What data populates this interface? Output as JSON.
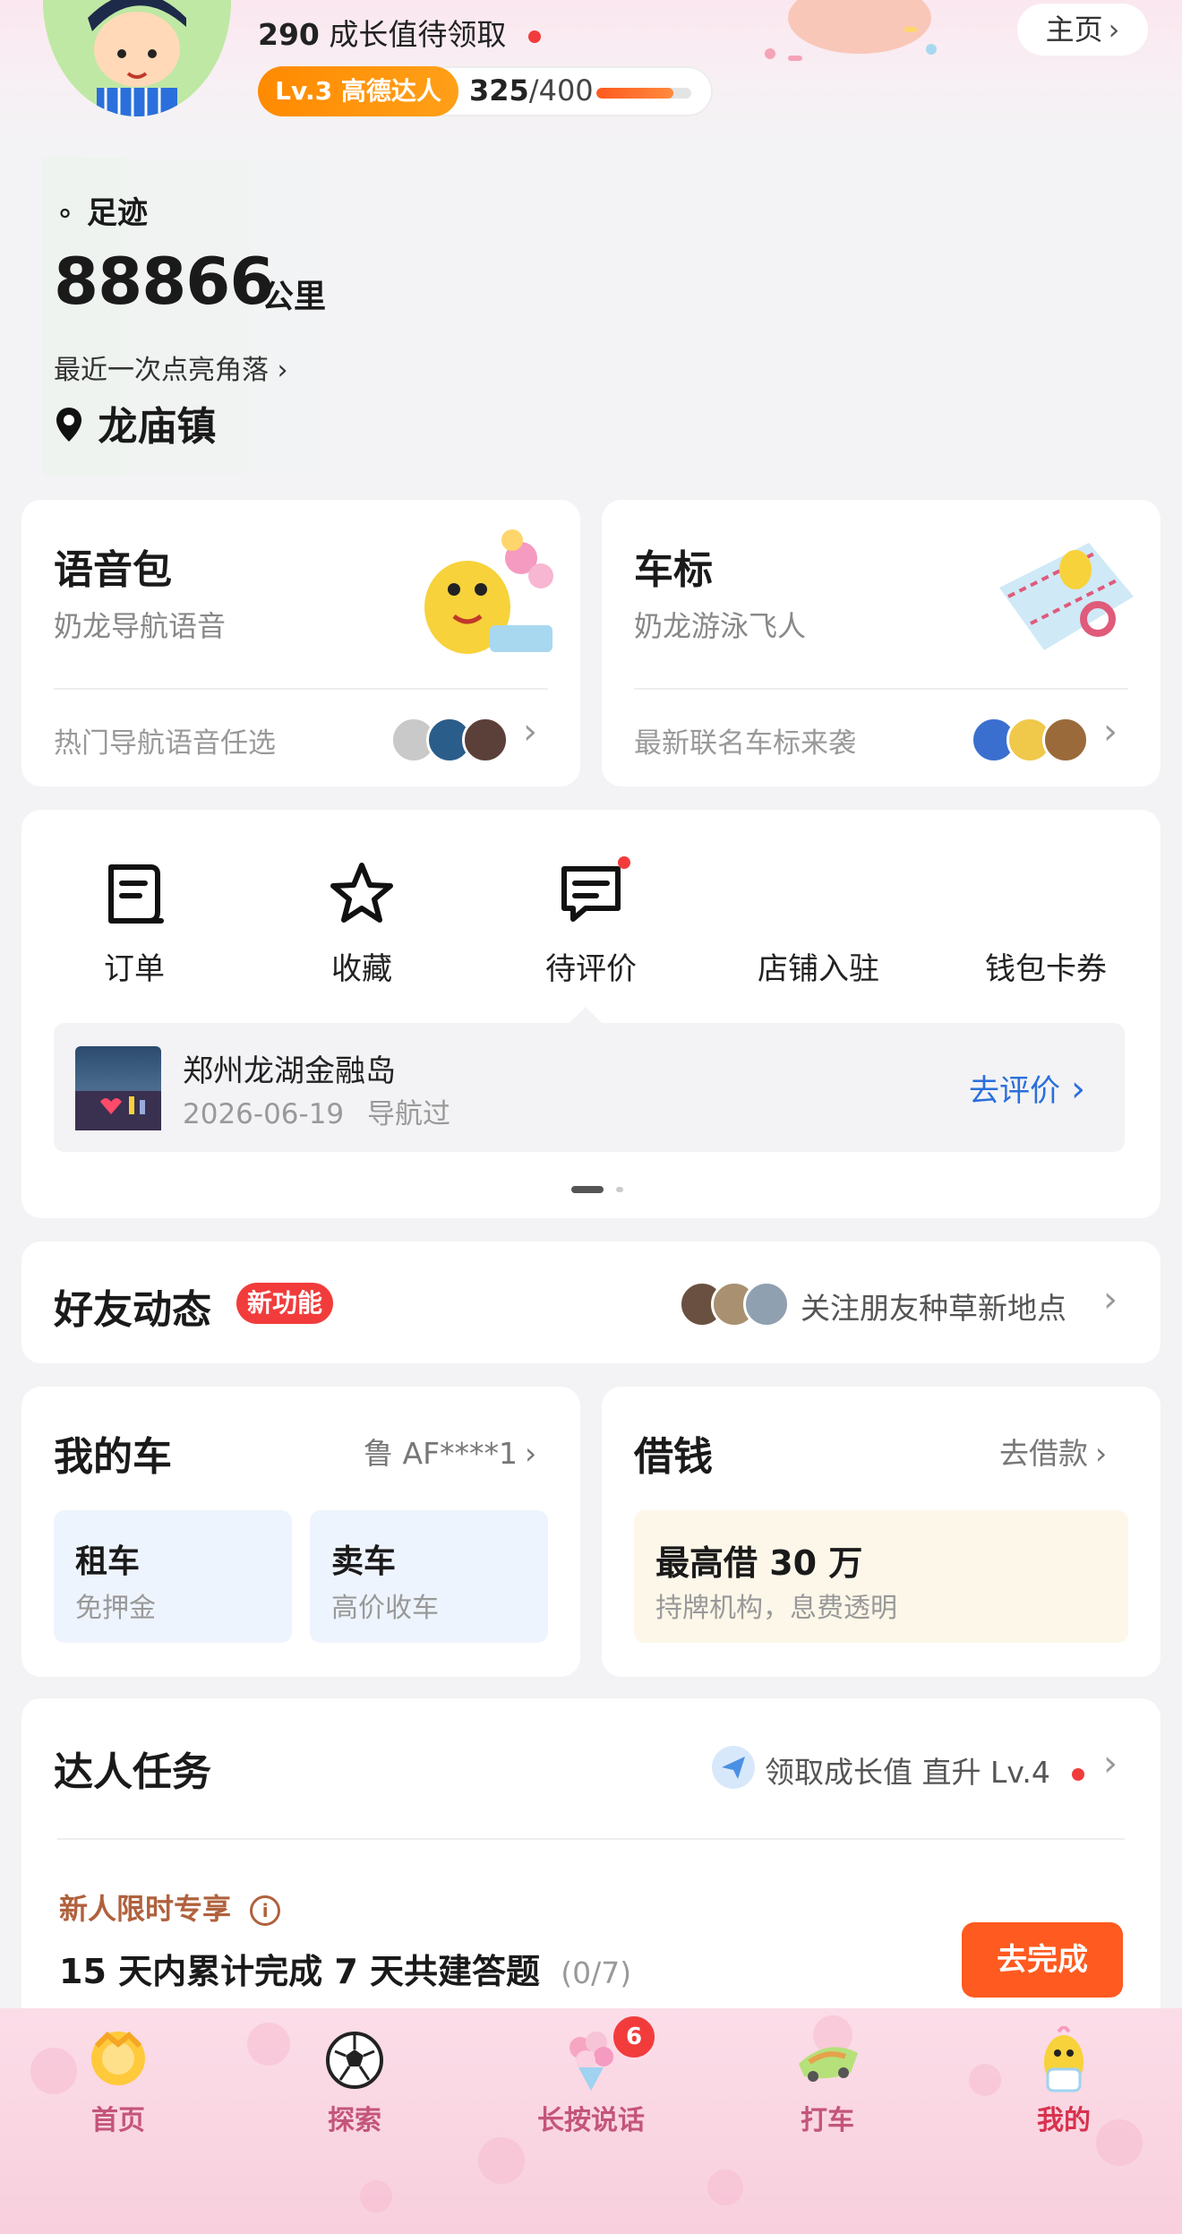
{
  "header": {
    "growth_points": "290",
    "growth_text": "成长值待领取",
    "level_badge": "Lv.3 高德达人",
    "level_current": "325",
    "level_max": "/400",
    "level_progress": 0.8125,
    "home_label": "主页"
  },
  "footprint": {
    "title": "足迹",
    "distance": "88866",
    "distance_unit": "公里",
    "recent_label": "最近一次点亮角落",
    "place": "龙庙镇"
  },
  "voice_pack": {
    "title": "语音包",
    "subtitle": "奶龙导航语音",
    "footer": "热门导航语音任选"
  },
  "car_logo": {
    "title": "车标",
    "subtitle": "奶龙游泳飞人",
    "footer": "最新联名车标来袭"
  },
  "services": {
    "items": [
      {
        "label": "订单",
        "icon": "order-icon"
      },
      {
        "label": "收藏",
        "icon": "star-icon"
      },
      {
        "label": "待评价",
        "icon": "comment-icon"
      },
      {
        "label": "店铺入驻",
        "icon": "store-icon"
      },
      {
        "label": "钱包卡券",
        "icon": "wallet-icon"
      }
    ],
    "review": {
      "place": "郑州龙湖金融岛",
      "date": "2026-06-19",
      "action_note": "导航过",
      "button": "去评价"
    }
  },
  "friends": {
    "title": "好友动态",
    "badge": "新功能",
    "link": "关注朋友种草新地点"
  },
  "my_car": {
    "title": "我的车",
    "plate": "鲁 AF****1",
    "rent_title": "租车",
    "rent_sub": "免押金",
    "sell_title": "卖车",
    "sell_sub": "高价收车"
  },
  "borrow": {
    "title": "借钱",
    "link": "去借款",
    "promo_title": "最高借 30 万",
    "promo_sub": "持牌机构，息费透明"
  },
  "tasks": {
    "title": "达人任务",
    "link": "领取成长值 直升 Lv.4",
    "tag": "新人限时专享",
    "task_title": "15 天内累计完成 7 天共建答题",
    "task_progress": "(0/7)",
    "button": "去完成"
  },
  "bottom_nav": {
    "items": [
      {
        "label": "首页",
        "icon": "home-icon"
      },
      {
        "label": "探索",
        "icon": "soccer-ball-icon"
      },
      {
        "label": "长按说话",
        "icon": "bouquet-icon",
        "badge": "6"
      },
      {
        "label": "打车",
        "icon": "taxi-icon"
      },
      {
        "label": "我的",
        "icon": "profile-icon"
      }
    ]
  },
  "colors": {
    "accent_orange": "#ff5a1f",
    "link_blue": "#2a6fdb",
    "badge_red": "#f23c3c",
    "nav_active": "#d8324e"
  }
}
